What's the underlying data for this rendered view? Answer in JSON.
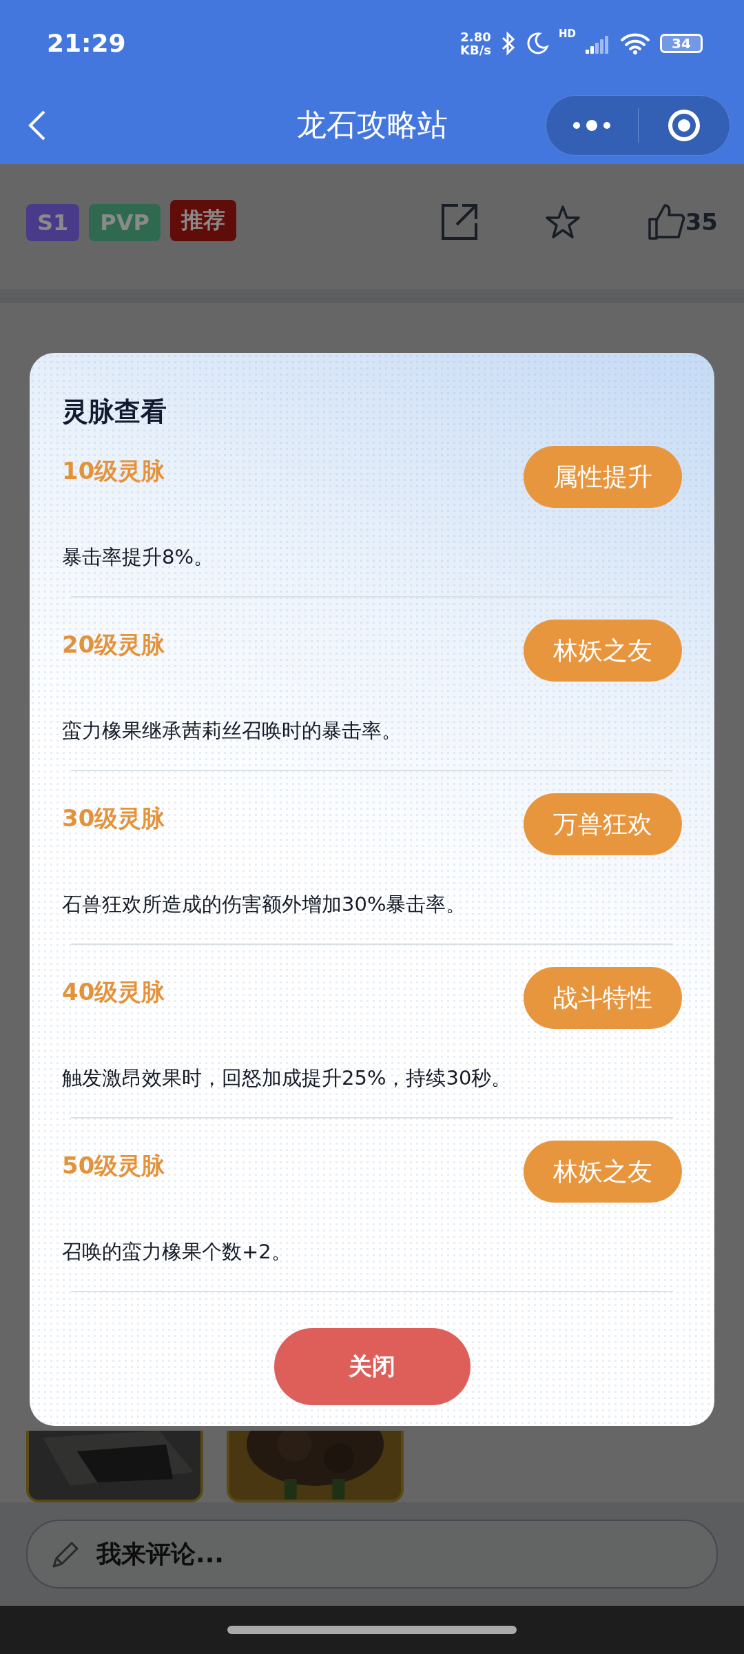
{
  "status_bar": {
    "time": "21:29",
    "speed_value": "2.80",
    "speed_unit": "KB/s",
    "network": "HD",
    "battery": "34"
  },
  "nav": {
    "title": "龙石攻略站"
  },
  "post": {
    "tags": [
      {
        "label": "S1",
        "color": "#4a3a8a"
      },
      {
        "label": "PVP",
        "color": "#2f6a50"
      },
      {
        "label": "推荐",
        "color": "#600c08"
      }
    ],
    "likes": "35"
  },
  "dialog": {
    "title": "灵脉查看",
    "veins": [
      {
        "level": "10级灵脉",
        "badge": "属性提升",
        "description": "暴击率提升8%。"
      },
      {
        "level": "20级灵脉",
        "badge": "林妖之友",
        "description": "蛮力橡果继承茜莉丝召唤时的暴击率。"
      },
      {
        "level": "30级灵脉",
        "badge": "万兽狂欢",
        "description": "石兽狂欢所造成的伤害额外增加30%暴击率。"
      },
      {
        "level": "40级灵脉",
        "badge": "战斗特性",
        "description": "触发激昂效果时，回怒加成提升25%，持续30秒。"
      },
      {
        "level": "50级灵脉",
        "badge": "林妖之友",
        "description": "召唤的蛮力橡果个数+2。"
      }
    ],
    "close_button": "关闭"
  },
  "comment": {
    "placeholder": "我来评论..."
  }
}
